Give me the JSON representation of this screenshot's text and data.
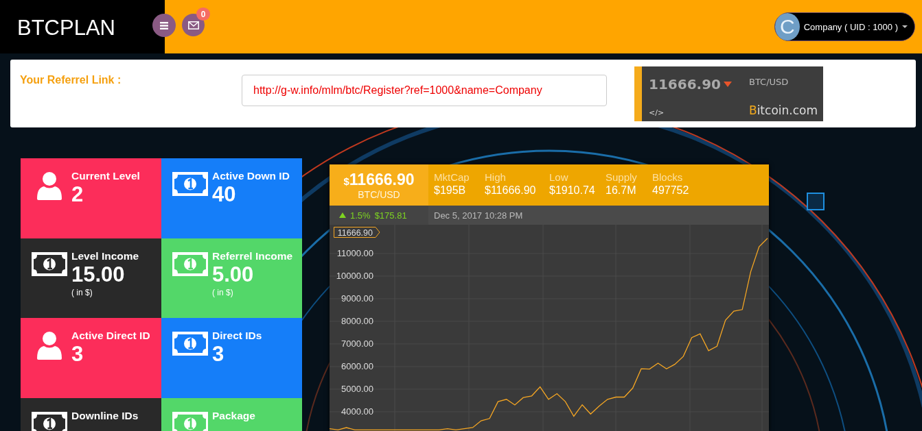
{
  "header": {
    "logo": "BTCPLAN",
    "mail_badge": "0",
    "user": {
      "avatar_letter": "C",
      "label": "Company ( UID : 1000 )"
    }
  },
  "referral": {
    "label": "Your Referrel Link :",
    "value": "http://g-w.info/mlm/btc/Register?ref=1000&name=Company"
  },
  "ticker": {
    "price": "11666.90",
    "trend_down": true,
    "pair": "BTC/USD",
    "embed": "</>",
    "brand": "Bitcoin.com"
  },
  "stats": [
    {
      "kind": "user",
      "title": "Current Level",
      "value": "2",
      "color": "#fc2d5a"
    },
    {
      "kind": "money",
      "title": "Active Down ID",
      "value": "40",
      "color": "#157ef9"
    },
    {
      "kind": "money",
      "title": "Level Income",
      "value": "15.00",
      "note": "( in $)",
      "color": "#292929"
    },
    {
      "kind": "money",
      "title": "Referrel Income",
      "value": "5.00",
      "note": "( in $)",
      "color": "#53d769"
    },
    {
      "kind": "user",
      "title": "Active Direct ID",
      "value": "3",
      "color": "#fc2d5a"
    },
    {
      "kind": "money",
      "title": "Direct IDs",
      "value": "3",
      "color": "#157ef9"
    },
    {
      "kind": "money",
      "title": "Downline IDs",
      "color": "#292929"
    },
    {
      "kind": "money",
      "title": "Package",
      "color": "#53d769"
    }
  ],
  "price_widget": {
    "price": "$11666.90",
    "pair": "BTC/USD",
    "metrics": [
      {
        "label": "MktCap",
        "value": "$195B"
      },
      {
        "label": "High",
        "value": "$11666.90"
      },
      {
        "label": "Low",
        "value": "$1910.74"
      },
      {
        "label": "Supply",
        "value": "16.7M"
      },
      {
        "label": "Blocks",
        "value": "497752"
      }
    ],
    "change_up": true,
    "change_percent": "1.5%",
    "change_amount": "$175.81",
    "timestamp": "Dec 5, 2017 10:28 PM",
    "price_tag": "11666.90",
    "chart_data": {
      "type": "line",
      "ylim": [
        3150,
        12270
      ],
      "grid": true,
      "yticks": [
        {
          "value": 4000,
          "label": "4000.00"
        },
        {
          "value": 5000,
          "label": "5000.00"
        },
        {
          "value": 6000,
          "label": "6000.00"
        },
        {
          "value": 7000,
          "label": "7000.00"
        },
        {
          "value": 8000,
          "label": "8000.00"
        },
        {
          "value": 9000,
          "label": "9000.00"
        },
        {
          "value": 10000,
          "label": "10000.00"
        },
        {
          "value": 11000,
          "label": "11000.00"
        }
      ],
      "series": [
        {
          "color": "#f5a623",
          "values": [
            3250,
            3200,
            3300,
            3200,
            3200,
            3200,
            3200,
            3200,
            3200,
            3200,
            3200,
            3200,
            3200,
            3200,
            3250,
            3200,
            3250,
            3300,
            3600,
            3700,
            4450,
            4550,
            4300,
            4630,
            4700,
            5100,
            4550,
            4800,
            4450,
            3800,
            4310,
            3900,
            4250,
            4550,
            4650,
            4650,
            5050,
            5900,
            5890,
            6150,
            5900,
            6100,
            6450,
            7280,
            7450,
            6700,
            6900,
            8050,
            8450,
            8520,
            10190,
            11300,
            11670
          ]
        }
      ]
    }
  }
}
